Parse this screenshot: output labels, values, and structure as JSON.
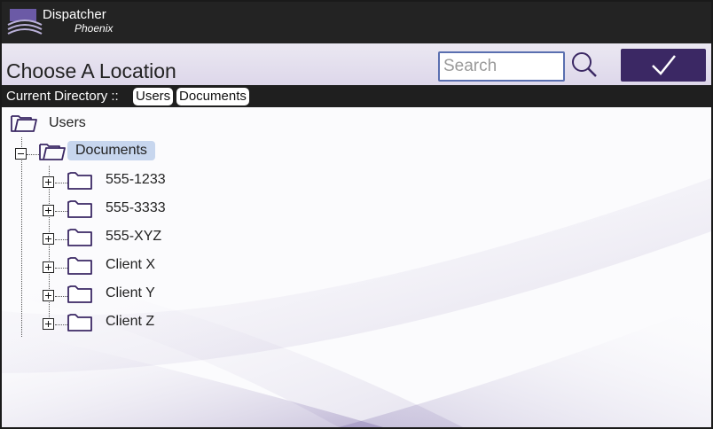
{
  "brand": {
    "name": "Dispatcher",
    "subtitle": "Phoenix"
  },
  "titlebar": {
    "title": "Choose A Location",
    "search_placeholder": "Search",
    "search_value": ""
  },
  "breadcrumb": {
    "label": "Current Directory ::",
    "parts": [
      "Users",
      "Documents"
    ]
  },
  "tree": {
    "root": {
      "label": "Users",
      "icon": "folder-open-icon"
    },
    "current": {
      "label": "Documents",
      "icon": "folder-open-icon",
      "expanded": true,
      "selected": true
    },
    "children": [
      {
        "label": "555-1233",
        "icon": "folder-icon",
        "expanded": false
      },
      {
        "label": "555-3333",
        "icon": "folder-icon",
        "expanded": false
      },
      {
        "label": "555-XYZ",
        "icon": "folder-icon",
        "expanded": false
      },
      {
        "label": "Client X",
        "icon": "folder-icon",
        "expanded": false
      },
      {
        "label": "Client Y",
        "icon": "folder-icon",
        "expanded": false
      },
      {
        "label": "Client Z",
        "icon": "folder-icon",
        "expanded": false
      }
    ]
  },
  "colors": {
    "brand_bar": "#232323",
    "accent_button": "#3b2864",
    "selected_node": "#c7d6ee",
    "folder_stroke": "#3b2864"
  }
}
